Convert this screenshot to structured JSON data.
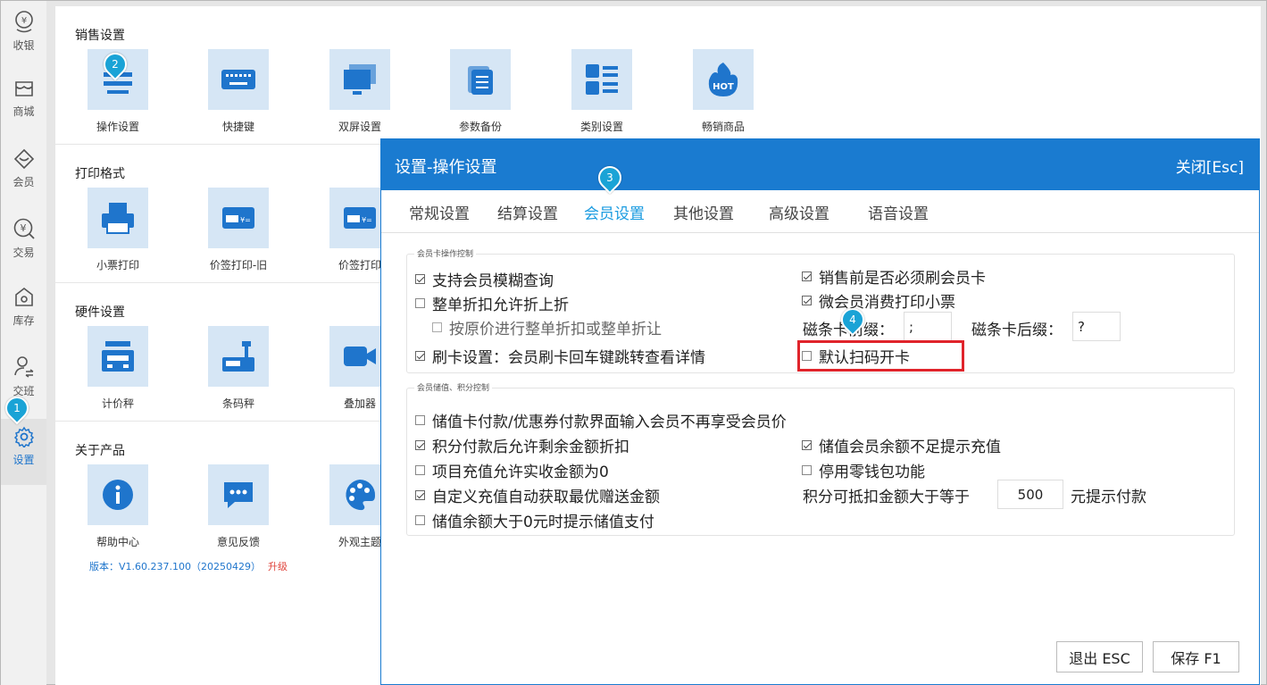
{
  "sidebar": {
    "items": [
      {
        "label": "收银",
        "icon": "cashier-icon"
      },
      {
        "label": "商城",
        "icon": "shop-icon"
      },
      {
        "label": "会员",
        "icon": "member-icon"
      },
      {
        "label": "交易",
        "icon": "transaction-icon"
      },
      {
        "label": "库存",
        "icon": "inventory-icon"
      },
      {
        "label": "交班",
        "icon": "shift-icon"
      },
      {
        "label": "设置",
        "icon": "gear-icon",
        "active": true
      }
    ]
  },
  "sections": {
    "sales": {
      "title": "销售设置",
      "tiles": [
        {
          "label": "操作设置",
          "icon": "operation-settings-icon"
        },
        {
          "label": "快捷键",
          "icon": "keyboard-icon"
        },
        {
          "label": "双屏设置",
          "icon": "dual-screen-icon"
        },
        {
          "label": "参数备份",
          "icon": "backup-icon"
        },
        {
          "label": "类别设置",
          "icon": "category-icon"
        },
        {
          "label": "畅销商品",
          "icon": "hot-icon",
          "icon_text": "HOT"
        }
      ]
    },
    "print": {
      "title": "打印格式",
      "tiles": [
        {
          "label": "小票打印",
          "icon": "printer-icon"
        },
        {
          "label": "价签打印-旧",
          "icon": "price-tag-icon"
        },
        {
          "label": "价签打印",
          "icon": "price-tag-icon"
        }
      ]
    },
    "hardware": {
      "title": "硬件设置",
      "tiles": [
        {
          "label": "计价秤",
          "icon": "pricing-scale-icon"
        },
        {
          "label": "条码秤",
          "icon": "barcode-scale-icon"
        },
        {
          "label": "叠加器",
          "icon": "video-camera-icon"
        }
      ]
    },
    "about": {
      "title": "关于产品",
      "tiles": [
        {
          "label": "帮助中心",
          "icon": "info-icon"
        },
        {
          "label": "意见反馈",
          "icon": "feedback-icon"
        },
        {
          "label": "外观主题",
          "icon": "palette-icon"
        }
      ],
      "version": "版本：V1.60.237.100（20250429）",
      "upgrade": "升级"
    }
  },
  "markers": [
    "1",
    "2",
    "3",
    "4"
  ],
  "dialog": {
    "title": "设置-操作设置",
    "close": "关闭[Esc]",
    "tabs": [
      "常规设置",
      "结算设置",
      "会员设置",
      "其他设置",
      "高级设置",
      "语音设置"
    ],
    "active_tab": "会员设置",
    "group1": {
      "legend": "会员卡操作控制",
      "left": [
        {
          "label": "支持会员模糊查询",
          "checked": true
        },
        {
          "label": "整单折扣允许折上折",
          "checked": false
        },
        {
          "label": "按原价进行整单折扣或整单折让",
          "checked": false
        },
        {
          "label": "刷卡设置：会员刷卡回车键跳转查看详情",
          "checked": true
        }
      ],
      "right": [
        {
          "label": "销售前是否必须刷会员卡",
          "checked": true
        },
        {
          "label": "微会员消费打印小票",
          "checked": true
        },
        {
          "label": "默认扫码开卡",
          "checked": false
        }
      ],
      "prefix_label": "磁条卡前缀：",
      "prefix_value": ";",
      "suffix_label": "磁条卡后缀：",
      "suffix_value": "?"
    },
    "group2": {
      "legend": "会员储值、积分控制",
      "left": [
        {
          "label": "储值卡付款/优惠券付款界面输入会员不再享受会员价",
          "checked": false
        },
        {
          "label": "积分付款后允许剩余金额折扣",
          "checked": true
        },
        {
          "label": "项目充值允许实收金额为0",
          "checked": false
        },
        {
          "label": "自定义充值自动获取最优赠送金额",
          "checked": true
        },
        {
          "label": "储值余额大于0元时提示储值支付",
          "checked": false
        }
      ],
      "right": [
        {
          "label": "储值会员余额不足提示充值",
          "checked": true
        },
        {
          "label": "停用零钱包功能",
          "checked": false
        }
      ],
      "points_label": "积分可抵扣金额大于等于",
      "points_value": "500",
      "points_suffix": "元提示付款"
    },
    "buttons": {
      "exit": "退出 ESC",
      "save": "保存 F1"
    }
  }
}
